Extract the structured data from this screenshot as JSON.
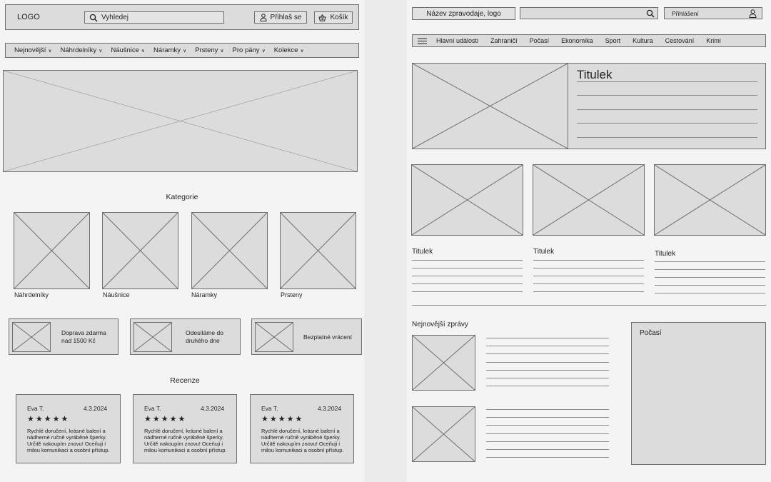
{
  "shop": {
    "logo": "LOGO",
    "search_placeholder": "Vyhledej",
    "login_label": "Přihlaš se",
    "cart_label": "Košík",
    "menu": [
      {
        "label": "Nejnovější"
      },
      {
        "label": "Náhrdelníky"
      },
      {
        "label": "Náušnice"
      },
      {
        "label": "Náramky"
      },
      {
        "label": "Prsteny"
      },
      {
        "label": "Pro pány"
      },
      {
        "label": "Kolekce"
      }
    ],
    "categories_title": "Kategorie",
    "categories": [
      {
        "label": "Náhrdelníky"
      },
      {
        "label": "Náušnice"
      },
      {
        "label": "Náramky"
      },
      {
        "label": "Prsteny"
      }
    ],
    "benefits": [
      {
        "text": "Doprava zdarma\nnad 1500 Kč"
      },
      {
        "text": "Odesíláme do\ndruhého dne"
      },
      {
        "text": "Bezplatné vrácení"
      }
    ],
    "reviews_title": "Recenze",
    "reviews": [
      {
        "author": "Eva T.",
        "date": "4.3.2024",
        "stars": "★★★★★",
        "rating": 5,
        "text": "Rychlé doručení, krásné balení a nádherné ručně vyráběné šperky. Určitě nakoupím znovu! Oceňuji i milou komunikaci a osobní přístup."
      },
      {
        "author": "Eva T.",
        "date": "4.3.2024",
        "stars": "★★★★★",
        "rating": 5,
        "text": "Rychlé doručení, krásné balení a nádherné ručně vyráběné šperky. Určitě nakoupím znovu! Oceňuji i milou komunikaci a osobní přístup."
      },
      {
        "author": "Eva T.",
        "date": "4.3.2024",
        "stars": "★★★★★",
        "rating": 5,
        "text": "Rychlé doručení, krásné balení a nádherné ručně vyráběné šperky. Určitě nakoupím znovu! Oceňuji i milou komunikaci a osobní přístup."
      }
    ]
  },
  "news": {
    "logo_label": "Název zpravodaje, logo",
    "login_label": "Přihlášení",
    "menu": [
      {
        "label": "Hlavní události"
      },
      {
        "label": "Zahraničí"
      },
      {
        "label": "Počasí"
      },
      {
        "label": "Ekonomika"
      },
      {
        "label": "Sport"
      },
      {
        "label": "Kultura"
      },
      {
        "label": "Cestování"
      },
      {
        "label": "Krimi"
      }
    ],
    "hero_title": "Titulek",
    "articles": [
      {
        "title": "Titulek"
      },
      {
        "title": "Titulek"
      },
      {
        "title": "Titulek"
      }
    ],
    "latest_title": "Nejnovější zprávy",
    "weather_title": "Počasí"
  },
  "icons": {
    "search": "search-icon",
    "user": "user-icon",
    "cart": "basket-icon",
    "chevron": "chevron-down-icon",
    "hamburger": "hamburger-menu-icon"
  },
  "colors": {
    "background": "#f4f4f4",
    "placeholder": "#dcdcdc",
    "border": "#6f6f6f"
  }
}
